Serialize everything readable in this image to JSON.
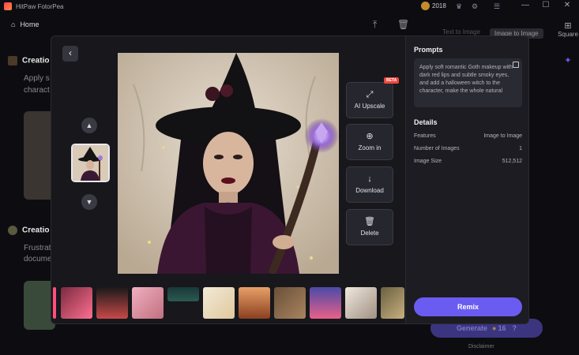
{
  "window": {
    "title": "HitPaw FotorPea",
    "coins": "2018"
  },
  "background": {
    "home_label": "Home",
    "card1_title": "Creatio",
    "card1_sub1": "Apply s",
    "card1_sub2": "charact",
    "card2_title": "Creatio",
    "card2_sub1": "Frustrat",
    "card2_sub2": "docume",
    "tab_text_to_image": "Text to Image",
    "tab_image_to_image": "Image to Image",
    "square_label": "Square",
    "generate_label": "Generate",
    "generate_cost": "16",
    "disclaimer": "Disclaimer"
  },
  "tools": {
    "upscale_label": "AI Upscale",
    "beta_badge": "BETA",
    "zoom_label": "Zoom in",
    "download_label": "Download",
    "delete_label": "Delete"
  },
  "panel": {
    "prompts_title": "Prompts",
    "prompt_text": "Apply soft romantic Goth makeup with dark red lips and subtle smoky eyes, and add a halloween witch to the character, make the whole natural",
    "details_title": "Details",
    "details": [
      {
        "label": "Features",
        "value": "Image to Image"
      },
      {
        "label": "Number of Images",
        "value": "1"
      },
      {
        "label": "Image Size",
        "value": "512,512"
      }
    ],
    "remix_label": "Remix"
  },
  "colors": {
    "accent": "#6a5cf0",
    "beta": "#f0463c",
    "coin": "#c58a2f"
  }
}
